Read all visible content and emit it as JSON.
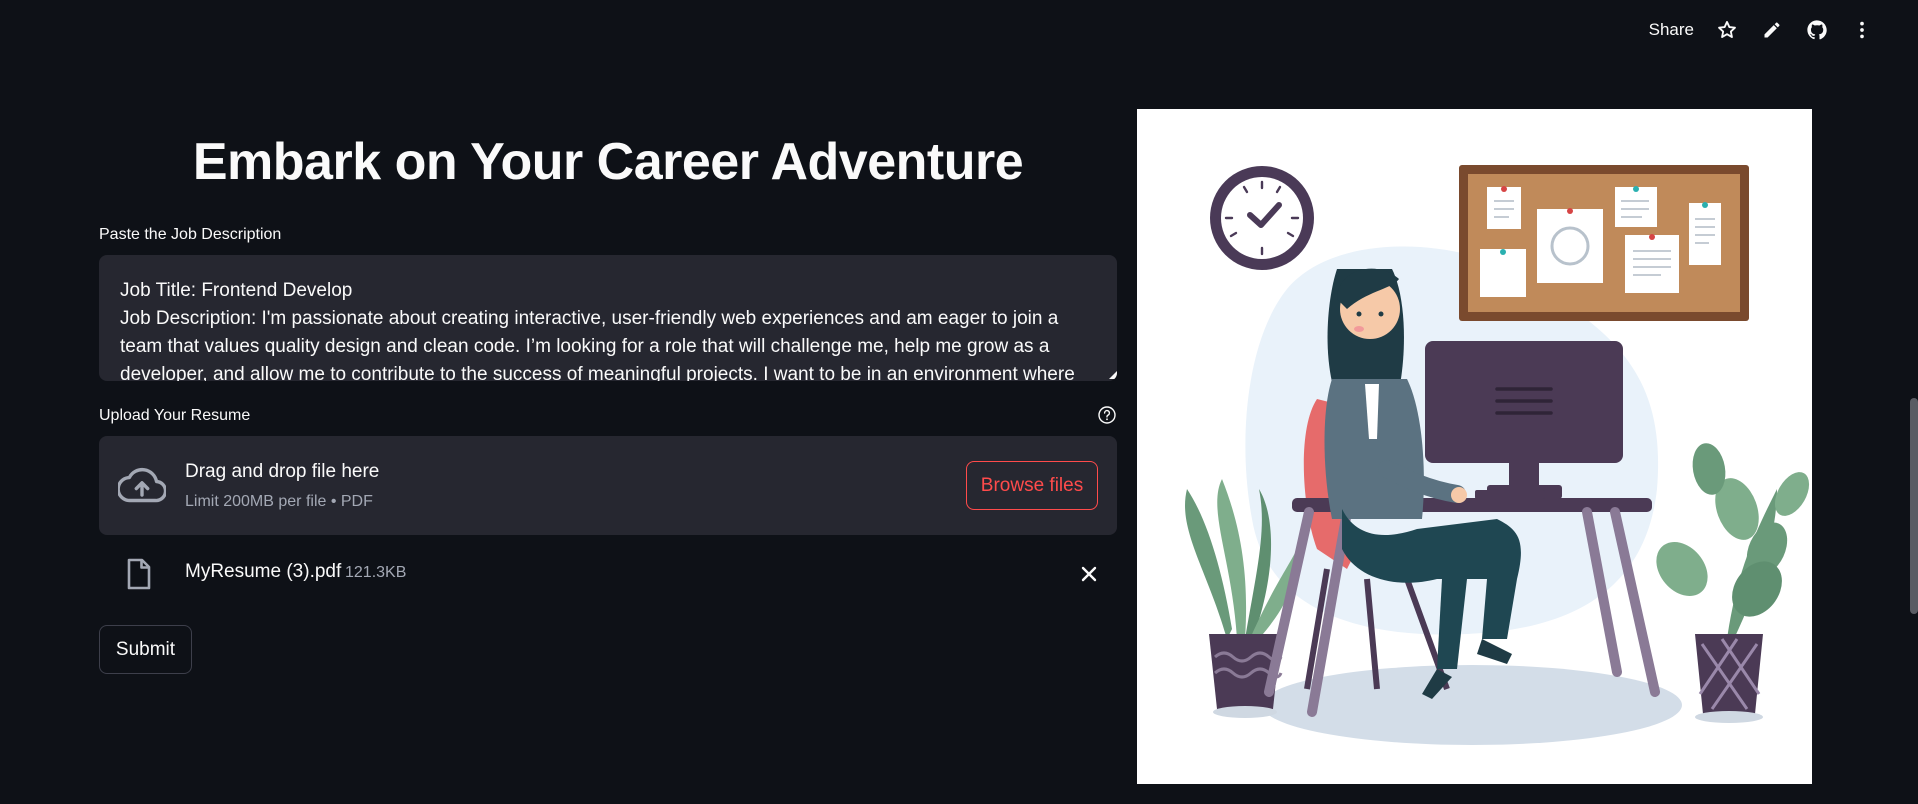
{
  "toolbar": {
    "share_label": "Share"
  },
  "main": {
    "title": "Embark on Your Career Adventure",
    "job_description": {
      "label": "Paste the Job Description",
      "value": "Job Title: Frontend Develop\nJob Description: I'm passionate about creating interactive, user-friendly web experiences and am eager to join a team that values quality design and clean code. I’m looking for a role that will challenge me, help me grow as a developer, and allow me to contribute to the success of meaningful projects. I want to be in an environment where"
    },
    "resume": {
      "label": "Upload Your Resume",
      "dropzone_title": "Drag and drop file here",
      "dropzone_limit": "Limit 200MB per file • PDF",
      "browse_label": "Browse files",
      "file_name": "MyResume (3).pdf",
      "file_size": "121.3KB"
    },
    "submit_label": "Submit"
  },
  "colors": {
    "background": "#0e1117",
    "surface": "#262730",
    "accent": "#ff4b4b",
    "muted_text": "#a3a8b4"
  },
  "icons": [
    "star-icon",
    "pencil-icon",
    "github-icon",
    "more-vertical-icon",
    "help-icon",
    "cloud-upload-icon",
    "file-icon",
    "close-icon"
  ]
}
